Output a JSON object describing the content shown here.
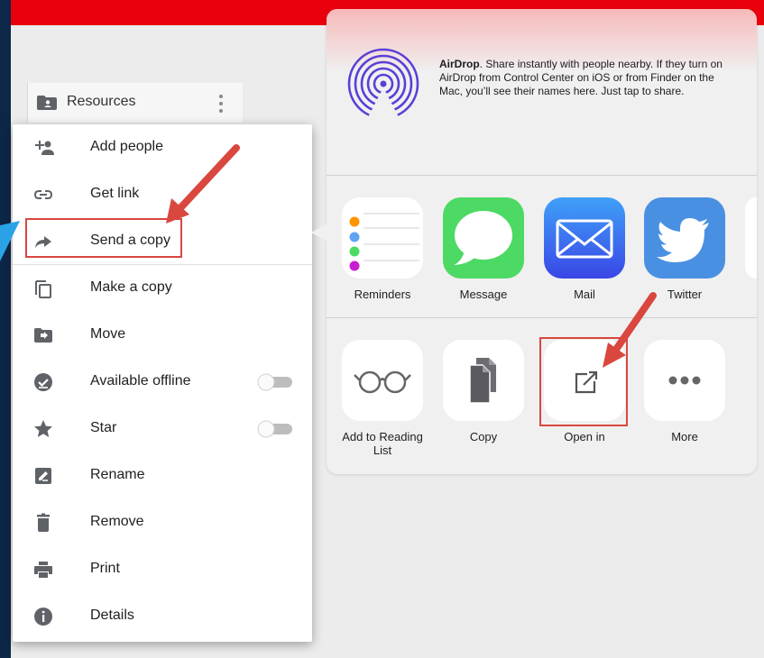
{
  "page": {
    "accent_red": "#e8000d",
    "highlight_red": "#d9473f"
  },
  "resources_bar": {
    "label": "Resources"
  },
  "context_menu": {
    "items": [
      {
        "label": "Add people",
        "icon": "add-people-icon"
      },
      {
        "label": "Get link",
        "icon": "link-icon"
      },
      {
        "label": "Send a copy",
        "icon": "share-arrow-icon",
        "highlighted": true
      },
      {
        "label": "Make a copy",
        "icon": "copy-icon"
      },
      {
        "label": "Move",
        "icon": "move-folder-icon"
      },
      {
        "label": "Available offline",
        "icon": "offline-check-icon",
        "toggle": false
      },
      {
        "label": "Star",
        "icon": "star-icon",
        "toggle": false
      },
      {
        "label": "Rename",
        "icon": "rename-icon"
      },
      {
        "label": "Remove",
        "icon": "trash-icon"
      },
      {
        "label": "Print",
        "icon": "print-icon"
      },
      {
        "label": "Details",
        "icon": "info-icon"
      }
    ]
  },
  "share_sheet": {
    "airdrop": {
      "title": "AirDrop",
      "text": ". Share instantly with people nearby. If they turn on AirDrop from Control Center on iOS or from Finder on the Mac, you’ll see their names here. Just tap to share."
    },
    "apps": [
      {
        "label": "Reminders",
        "icon": "reminders-icon"
      },
      {
        "label": "Message",
        "icon": "message-icon",
        "color": "#4cd964"
      },
      {
        "label": "Mail",
        "icon": "mail-icon",
        "color": "#3a6ff3"
      },
      {
        "label": "Twitter",
        "icon": "twitter-icon",
        "color": "#4a90e2"
      }
    ],
    "actions": [
      {
        "label": "Add to Reading List",
        "icon": "glasses-icon"
      },
      {
        "label": "Copy",
        "icon": "copy-docs-icon"
      },
      {
        "label": "Open in",
        "icon": "open-in-icon",
        "highlighted": true
      },
      {
        "label": "More",
        "icon": "more-icon"
      }
    ]
  }
}
